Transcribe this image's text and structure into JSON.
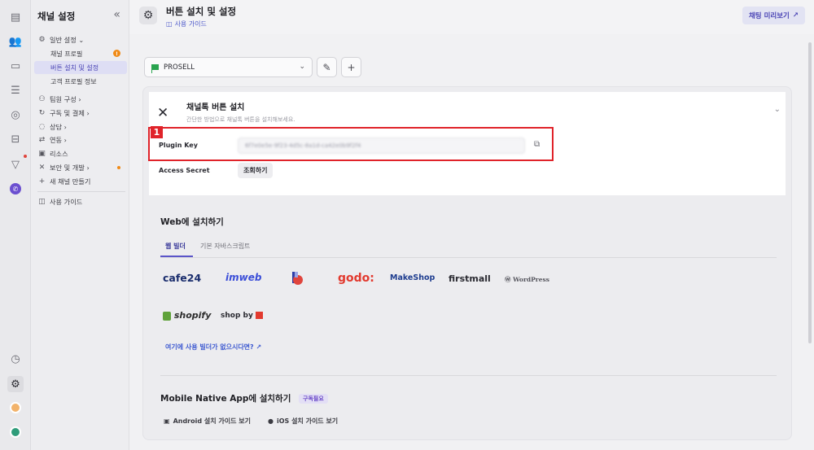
{
  "rail": {
    "icons": [
      "document-icon",
      "users-icon",
      "inbox-icon",
      "list-icon",
      "badge-icon",
      "robot-icon",
      "filter-icon",
      "phone-icon"
    ],
    "bottom_icons": [
      "clock-icon",
      "gear-icon",
      "avatar",
      "avatar-secondary"
    ]
  },
  "sidebar": {
    "title": "채널 설정",
    "items": [
      {
        "label": "일반 설정 ⌄",
        "icon": "gear-icon"
      },
      {
        "label": "채널 프로필"
      },
      {
        "label": "버튼 설치 및 설정"
      },
      {
        "label": "고객 프로필 정보"
      },
      {
        "label": "팀원 구성 ›",
        "icon": "users-icon"
      },
      {
        "label": "구독 및 결제 ›",
        "icon": "refresh-icon"
      },
      {
        "label": "상담 ›",
        "icon": "chat-icon"
      },
      {
        "label": "연동 ›",
        "icon": "swap-icon"
      },
      {
        "label": "리소스",
        "icon": "resource-icon"
      },
      {
        "label": "보안 및 개발 ›",
        "icon": "tools-icon"
      },
      {
        "label": "새 채널 만들기",
        "icon": "plus-icon"
      },
      {
        "label": "사용 가이드",
        "icon": "book-icon"
      }
    ],
    "warn_badge": "!"
  },
  "header": {
    "title": "버튼 설치 및 설정",
    "guide_link": "사용 가이드",
    "preview_button": "채팅 미리보기"
  },
  "channel_selector": {
    "value": "PROSELL"
  },
  "key_panel": {
    "title": "채널톡 버튼 설치",
    "description": "간단한 방법으로 채널톡 버튼을 설치해보세요.",
    "plugin_key_label": "Plugin Key",
    "plugin_key_value": "6f7e0e5e-9f23-4d5c-8a1d-ca42e0b9f2f4",
    "access_secret_label": "Access Secret",
    "view_button": "조회하기",
    "annotation_number": "1"
  },
  "web_install": {
    "title": "Web에 설치하기",
    "tabs": [
      "웹 빌더",
      "기본 자바스크립트"
    ],
    "builders_row1": [
      "cafe24",
      "imweb",
      "",
      "godo:",
      "MakeShop",
      "firstmall",
      "WordPress"
    ],
    "builders_row2": [
      "shopify",
      "shop by"
    ],
    "help_link": "여기에 사용 빌더가 없으시다면?"
  },
  "mobile_install": {
    "title": "Mobile Native App에 설치하기",
    "pill": "구독필요",
    "android_link": "Android 설치 가이드 보기",
    "ios_link": "iOS 설치 가이드 보기"
  },
  "colors": {
    "accent": "#4a44b5",
    "highlight": "#e0232a",
    "link": "#3e5ad1"
  }
}
